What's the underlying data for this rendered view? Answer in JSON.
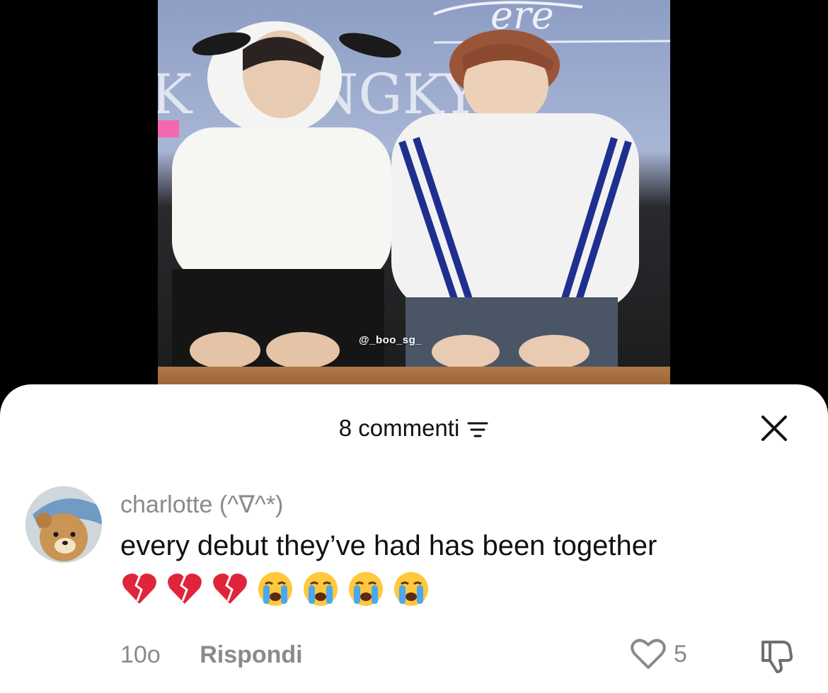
{
  "video": {
    "watermark": "@_boo_sg_"
  },
  "sheet": {
    "comment_count_label": "8 commenti",
    "icons": {
      "filter": "filter-icon",
      "close": "close-icon"
    }
  },
  "comment": {
    "username": "charlotte (^∇^*)",
    "text": "every debut they’ve had has been together",
    "emojis": [
      "broken-heart",
      "broken-heart",
      "broken-heart",
      "crying-face",
      "crying-face",
      "crying-face",
      "crying-face"
    ],
    "time": "10o",
    "reply_label": "Rispondi",
    "like_count": "5",
    "icons": {
      "like": "heart-outline-icon",
      "dislike": "thumbs-down-icon"
    }
  },
  "colors": {
    "sheet_bg": "#ffffff",
    "muted_text": "#8a8a8a",
    "primary_text": "#111111",
    "page_bg": "#000000"
  }
}
